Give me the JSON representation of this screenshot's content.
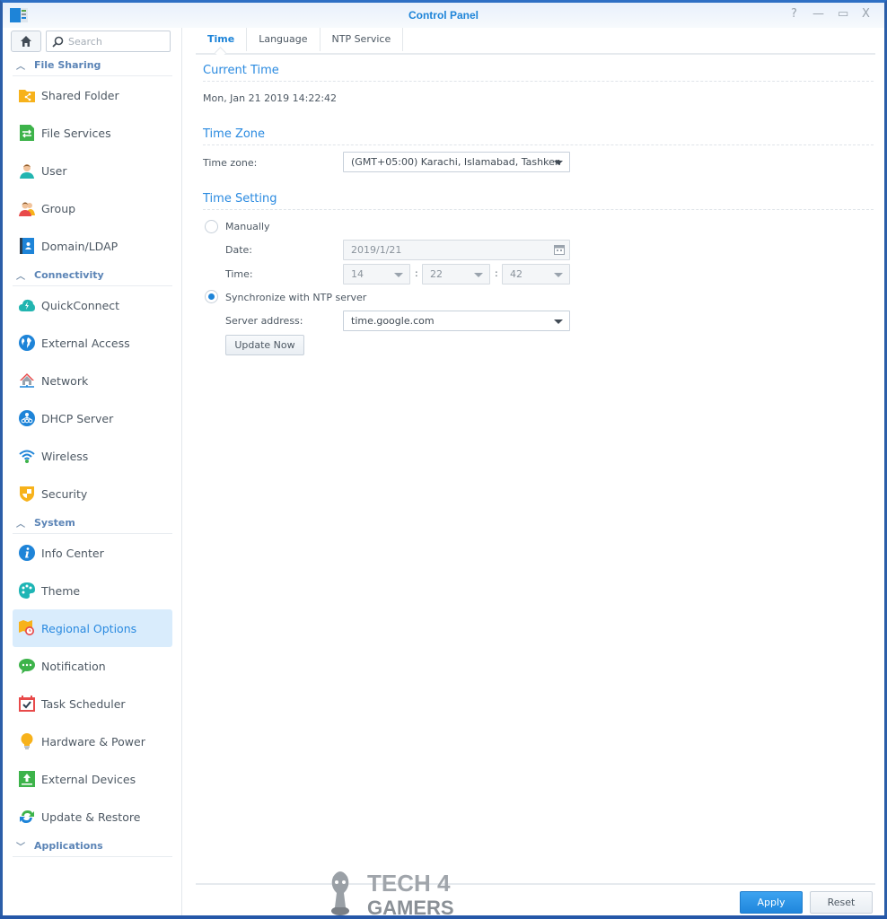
{
  "window": {
    "title": "Control Panel",
    "controls": {
      "help": "?",
      "minimize": "—",
      "maximize": "▭",
      "close": "X"
    }
  },
  "sidebar": {
    "search_placeholder": "Search",
    "groups": [
      {
        "label": "File Sharing",
        "expanded": true,
        "items": [
          {
            "label": "Shared Folder",
            "icon": "shared-folder-icon"
          },
          {
            "label": "File Services",
            "icon": "file-services-icon"
          },
          {
            "label": "User",
            "icon": "user-icon"
          },
          {
            "label": "Group",
            "icon": "group-icon"
          },
          {
            "label": "Domain/LDAP",
            "icon": "domain-ldap-icon"
          }
        ]
      },
      {
        "label": "Connectivity",
        "expanded": true,
        "items": [
          {
            "label": "QuickConnect",
            "icon": "quickconnect-icon"
          },
          {
            "label": "External Access",
            "icon": "globe-icon"
          },
          {
            "label": "Network",
            "icon": "network-house-icon"
          },
          {
            "label": "DHCP Server",
            "icon": "dhcp-icon"
          },
          {
            "label": "Wireless",
            "icon": "wifi-icon"
          },
          {
            "label": "Security",
            "icon": "shield-icon"
          }
        ]
      },
      {
        "label": "System",
        "expanded": true,
        "items": [
          {
            "label": "Info Center",
            "icon": "info-icon"
          },
          {
            "label": "Theme",
            "icon": "palette-icon"
          },
          {
            "label": "Regional Options",
            "icon": "regional-map-clock-icon",
            "active": true
          },
          {
            "label": "Notification",
            "icon": "chat-bubble-icon"
          },
          {
            "label": "Task Scheduler",
            "icon": "calendar-check-icon"
          },
          {
            "label": "Hardware & Power",
            "icon": "lightbulb-icon"
          },
          {
            "label": "External Devices",
            "icon": "external-device-icon"
          },
          {
            "label": "Update & Restore",
            "icon": "refresh-icon"
          }
        ]
      },
      {
        "label": "Applications",
        "expanded": false,
        "items": []
      }
    ]
  },
  "tabs": [
    {
      "label": "Time",
      "active": true
    },
    {
      "label": "Language",
      "active": false
    },
    {
      "label": "NTP Service",
      "active": false
    }
  ],
  "current_time": {
    "title": "Current Time",
    "value": "Mon, Jan 21 2019 14:22:42"
  },
  "time_zone": {
    "title": "Time Zone",
    "label": "Time zone:",
    "value": "(GMT+05:00) Karachi, Islamabad, Tashken"
  },
  "time_setting": {
    "title": "Time Setting",
    "manual_label": "Manually",
    "manual_selected": false,
    "date_label": "Date:",
    "date_value": "2019/1/21",
    "time_label": "Time:",
    "hour": "14",
    "minute": "22",
    "second": "42",
    "separator": ":",
    "ntp_label": "Synchronize with NTP server",
    "ntp_selected": true,
    "server_label": "Server address:",
    "server_value": "time.google.com",
    "update_button": "Update Now"
  },
  "footer": {
    "apply": "Apply",
    "reset": "Reset"
  },
  "watermark": {
    "line1": "TECH 4",
    "line2": "GAMERS"
  },
  "colors": {
    "accent": "#1e84d8",
    "active_bg": "#d9ecfc",
    "window_border": "#2b5ea8"
  }
}
